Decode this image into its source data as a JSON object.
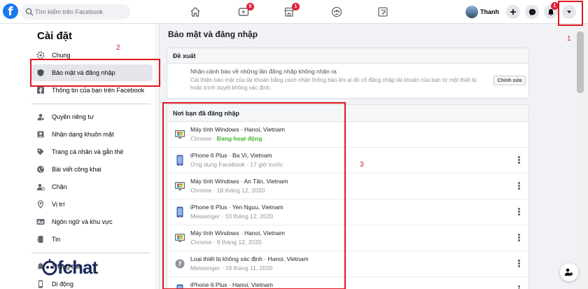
{
  "topbar": {
    "logo": "f",
    "search_placeholder": "Tìm kiếm trên Facebook",
    "nav": [
      {
        "icon": "home-icon",
        "badge": ""
      },
      {
        "icon": "watch-icon",
        "badge": "9"
      },
      {
        "icon": "marketplace-icon",
        "badge": "1"
      },
      {
        "icon": "groups-icon",
        "badge": ""
      },
      {
        "icon": "gaming-icon",
        "badge": ""
      }
    ],
    "profile_name": "Thanh",
    "notifications_badge": "1"
  },
  "sidebar": {
    "title": "Cài đặt",
    "group1": [
      {
        "label": "Chung",
        "icon": "gear-icon"
      },
      {
        "label": "Bảo mật và đăng nhập",
        "icon": "shield-icon"
      },
      {
        "label": "Thông tin của bạn trên Facebook",
        "icon": "facebook-info-icon"
      }
    ],
    "group2": [
      {
        "label": "Quyền riêng tư",
        "icon": "privacy-icon"
      },
      {
        "label": "Nhận dạng khuôn mặt",
        "icon": "face-recognition-icon"
      },
      {
        "label": "Trang cá nhân và gắn thẻ",
        "icon": "profile-tag-icon"
      },
      {
        "label": "Bài viết công khai",
        "icon": "globe-icon"
      },
      {
        "label": "Chặn",
        "icon": "block-icon"
      },
      {
        "label": "Vị trí",
        "icon": "location-icon"
      },
      {
        "label": "Ngôn ngữ và khu vực",
        "icon": "language-icon"
      },
      {
        "label": "Tin",
        "icon": "stories-icon"
      }
    ],
    "group3": [
      {
        "label": "Thông báo",
        "icon": "bell-icon"
      },
      {
        "label": "Di động",
        "icon": "mobile-icon"
      }
    ]
  },
  "main": {
    "title": "Bảo mật và đăng nhập",
    "suggestions": {
      "header": "Đề xuất",
      "item_title": "Nhận cảnh báo về những lần đăng nhập không nhận ra",
      "item_desc": "Cải thiện bảo mật của tài khoản bằng cách nhận thông báo khi ai đó cố đăng nhập tài khoản của bạn từ một thiết bị hoặc trình duyệt không xác định.",
      "edit_label": "Chỉnh sửa"
    },
    "where_logged_in": {
      "header": "Nơi bạn đã đăng nhập",
      "rows": [
        {
          "device": "windows",
          "title": "Máy tính Windows · Hanoi, Vietnam",
          "app": "Chrome · ",
          "time": "",
          "active": "Đang hoạt động",
          "menu": false
        },
        {
          "device": "phone",
          "title": "iPhone 6 Plus · Ba Vì, Vietnam",
          "app": "Ứng dụng Facebook · ",
          "time": "17 giờ trước",
          "active": "",
          "menu": true
        },
        {
          "device": "windows",
          "title": "Máy tính Windows · An Tân, Vietnam",
          "app": "Chrome · ",
          "time": "18 tháng 12, 2020",
          "active": "",
          "menu": true
        },
        {
          "device": "phone",
          "title": "iPhone 6 Plus · Yen Nguu, Vietnam",
          "app": "Messenger · ",
          "time": "10 tháng 12, 2020",
          "active": "",
          "menu": true
        },
        {
          "device": "windows",
          "title": "Máy tính Windows · Hanoi, Vietnam",
          "app": "Chrome · ",
          "time": "9 tháng 12, 2020",
          "active": "",
          "menu": true
        },
        {
          "device": "unknown",
          "title": "Loại thiết bị không xác định · Hanoi, Vietnam",
          "app": "Messenger · ",
          "time": "19 tháng 11, 2020",
          "active": "",
          "menu": true
        },
        {
          "device": "phone",
          "title": "iPhone 6 Plus · Hanoi, Vietnam",
          "app": "",
          "time": "",
          "active": "",
          "menu": true
        }
      ]
    }
  },
  "annotations": {
    "one": "1",
    "two": "2",
    "three": "3"
  },
  "watermark": "fchat",
  "colors": {
    "brand": "#1877f2",
    "annotation": "#e0161f",
    "active": "#42b72a",
    "badge": "#e41e3f"
  }
}
